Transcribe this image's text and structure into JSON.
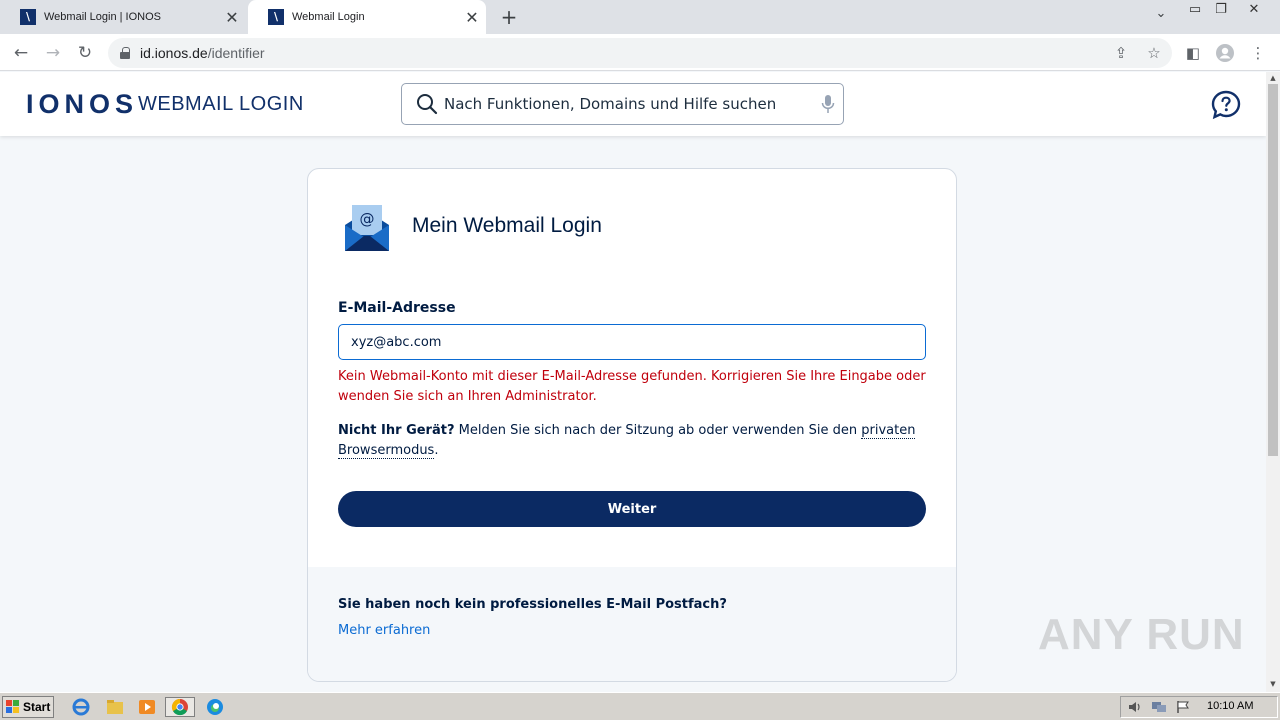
{
  "browser": {
    "tabs": [
      {
        "title": "Webmail Login | IONOS",
        "active": false
      },
      {
        "title": "Webmail Login",
        "active": true
      }
    ],
    "url": {
      "host": "id.ionos.de",
      "path": "/identifier"
    }
  },
  "header": {
    "logo": "IONOS",
    "product": "WEBMAIL LOGIN",
    "search_placeholder": "Nach Funktionen, Domains und Hilfe suchen"
  },
  "login": {
    "title": "Mein Webmail Login",
    "email_label": "E-Mail-Adresse",
    "email_value": "xyz@abc.com",
    "error": "Kein Webmail-Konto mit dieser E-Mail-Adresse gefunden. Korrigieren Sie Ihre Eingabe oder wenden Sie sich an Ihren Administrator.",
    "notice_bold": "Nicht Ihr Gerät?",
    "notice_text": " Melden Sie sich nach der Sitzung ab oder verwenden Sie den ",
    "notice_link": "privaten Browsermodus",
    "notice_end": ".",
    "submit_label": "Weiter"
  },
  "footer": {
    "question": "Sie haben noch kein professionelles E-Mail Postfach?",
    "link": "Mehr erfahren"
  },
  "watermark": "ANY RUN",
  "taskbar": {
    "start_label": "Start",
    "clock": "10:10 AM"
  },
  "colors": {
    "brand_navy": "#11306a",
    "button": "#0b2a63",
    "error": "#c0000c",
    "link": "#0b6bd3"
  }
}
